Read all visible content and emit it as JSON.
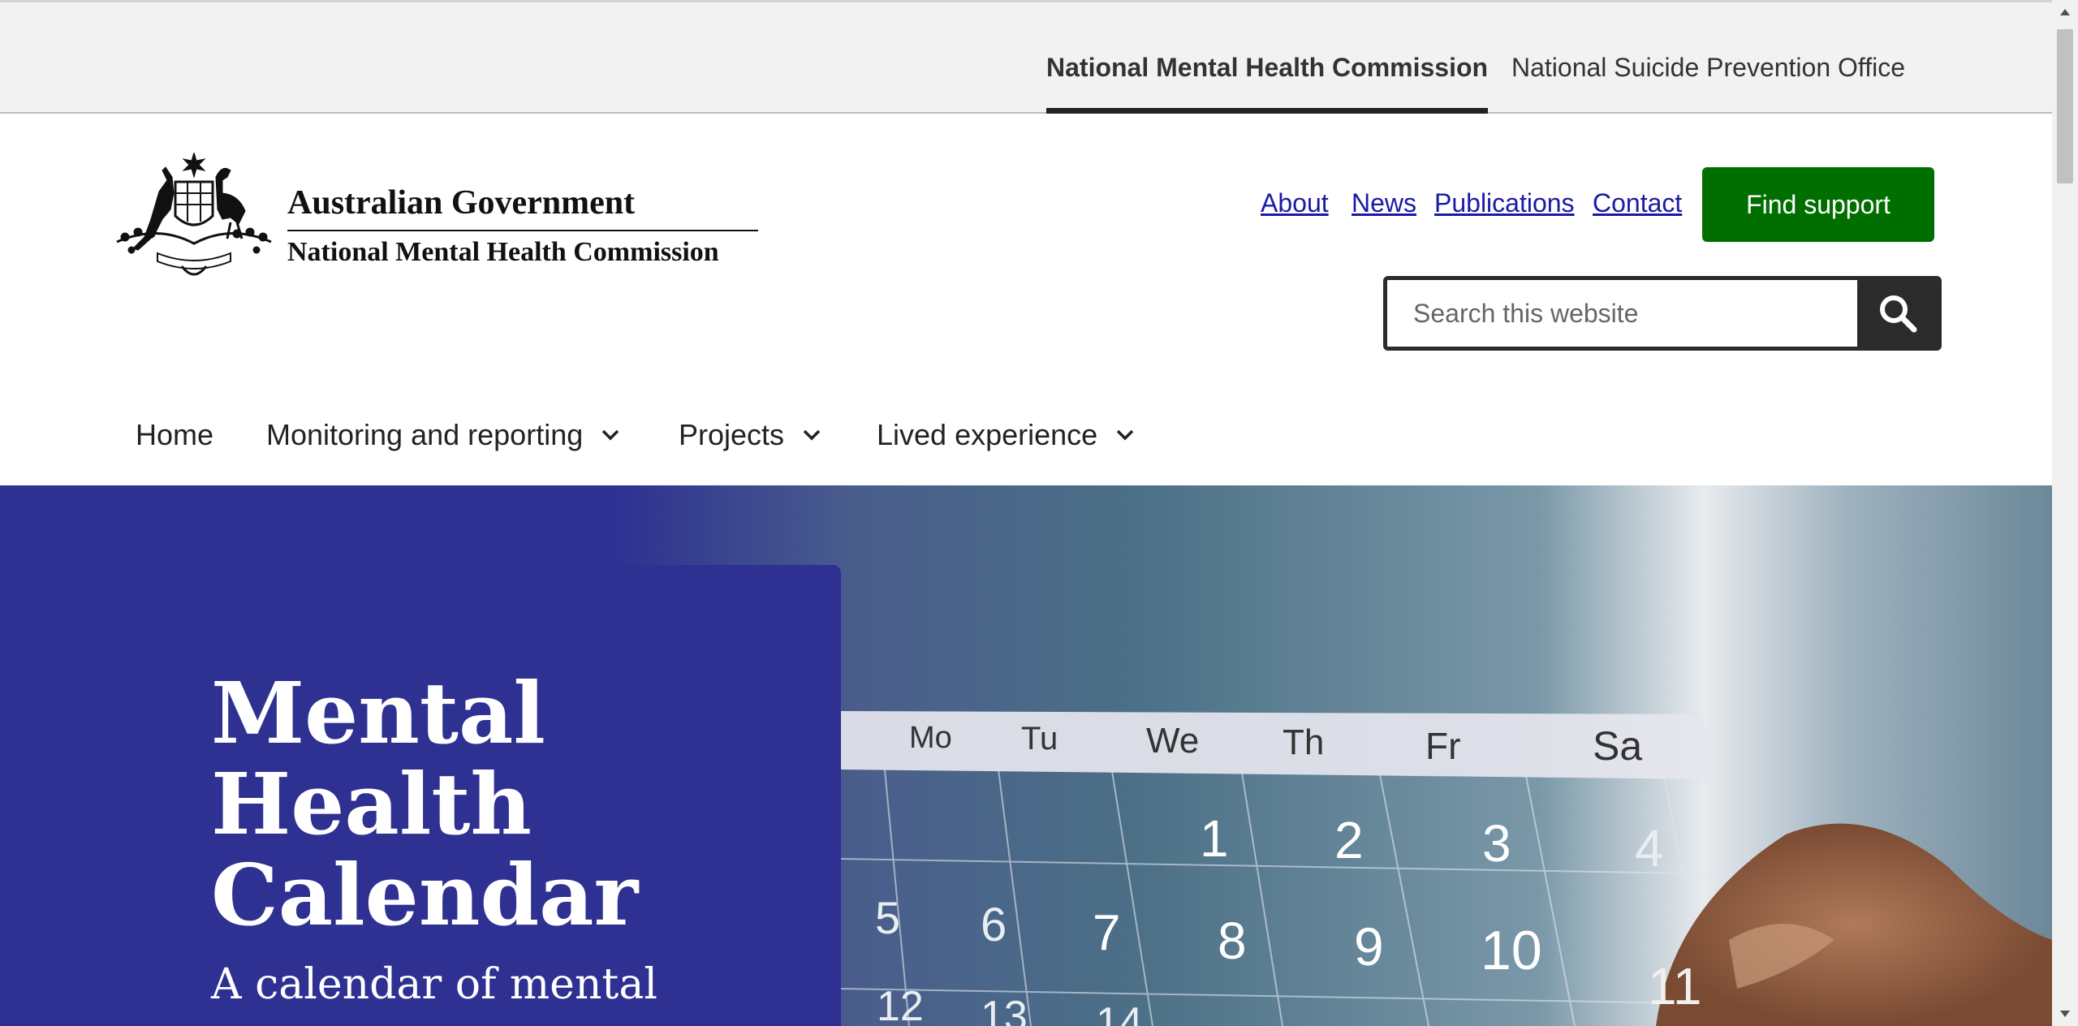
{
  "site_switcher": {
    "tabs": [
      {
        "label": "National Mental Health Commission",
        "active": true
      },
      {
        "label": "National Suicide Prevention Office",
        "active": false
      }
    ]
  },
  "logo": {
    "line1": "Australian Government",
    "line2": "National Mental Health Commission",
    "emblem_icon": "coat-of-arms-icon"
  },
  "utility_nav": {
    "links": [
      "About",
      "News",
      "Publications",
      "Contact"
    ]
  },
  "find_support": {
    "label": "Find support",
    "color": "#006f00"
  },
  "search": {
    "placeholder": "Search this website",
    "value": "",
    "icon": "search-icon"
  },
  "main_nav": {
    "items": [
      {
        "label": "Home",
        "has_dropdown": false
      },
      {
        "label": "Monitoring and reporting",
        "has_dropdown": true
      },
      {
        "label": "Projects",
        "has_dropdown": true
      },
      {
        "label": "Lived experience",
        "has_dropdown": true
      }
    ]
  },
  "hero": {
    "title": "Mental Health Calendar",
    "subtitle": "A calendar of mental",
    "panel_color": "#2e3192",
    "calendar_days": [
      "Mo",
      "Tu",
      "We",
      "Th",
      "Fr",
      "Sa"
    ],
    "calendar_numbers": [
      "1",
      "2",
      "3",
      "4",
      "5",
      "6",
      "7",
      "8",
      "9",
      "10",
      "11",
      "12",
      "13",
      "14"
    ]
  }
}
